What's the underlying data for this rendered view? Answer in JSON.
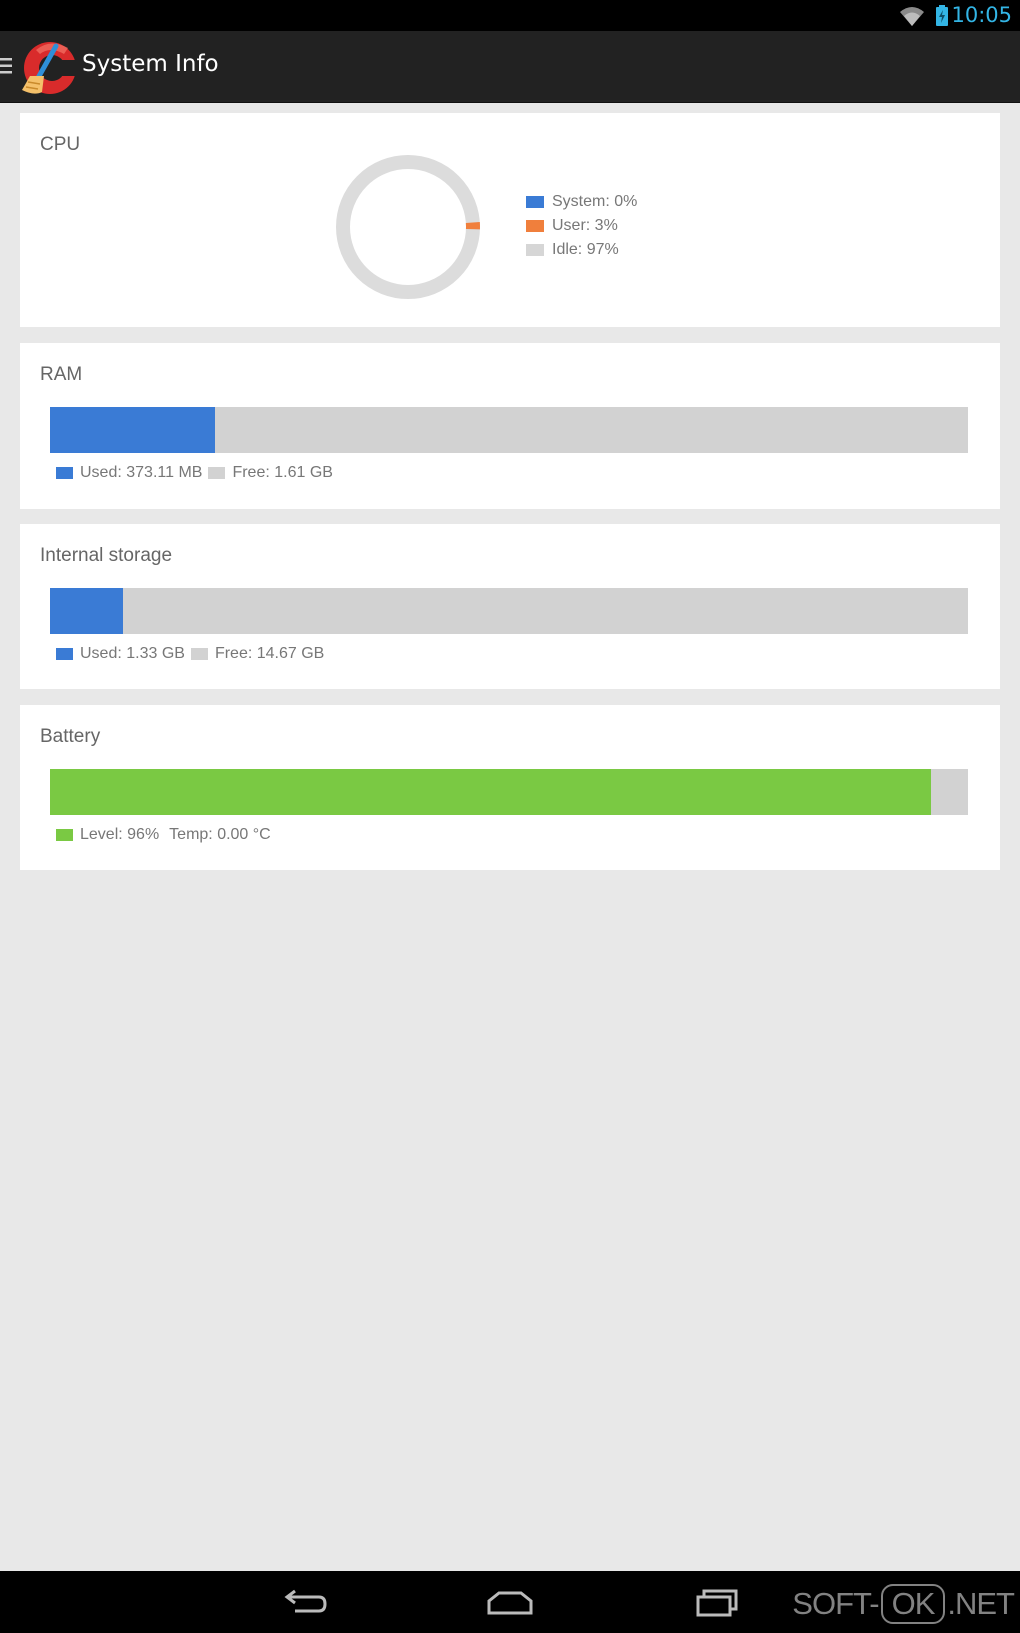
{
  "status_bar": {
    "time": "10:05",
    "icons": [
      "wifi-icon",
      "battery-icon"
    ]
  },
  "app_bar": {
    "title": "System Info",
    "icons": [
      "menu-icon",
      "ccleaner-logo-icon"
    ]
  },
  "cpu": {
    "title": "CPU",
    "legend": [
      {
        "label": "System: 0%",
        "color": "#3a7bd5"
      },
      {
        "label": "User: 3%",
        "color": "#f07f3c"
      },
      {
        "label": "Idle: 97%",
        "color": "#d6d6d6"
      }
    ],
    "usage_percent": {
      "system": 0,
      "user": 3,
      "idle": 97
    }
  },
  "ram": {
    "title": "RAM",
    "used_label": "Used: 373.11 MB",
    "free_label": "Free: 1.61 GB",
    "used_fraction": 0.18,
    "used_color": "#3a7bd5",
    "free_color": "#d2d2d2"
  },
  "storage": {
    "title": "Internal storage",
    "used_label": "Used: 1.33 GB",
    "free_label": "Free: 14.67 GB",
    "used_fraction": 0.08,
    "used_color": "#3a7bd5",
    "free_color": "#d2d2d2"
  },
  "battery": {
    "title": "Battery",
    "level_label": "Level: 96%",
    "temp_label": "Temp: 0.00 °C",
    "level_fraction": 0.96,
    "level_color": "#7ac943"
  },
  "nav_bar": {
    "icons": [
      "back-icon",
      "home-icon",
      "recent-apps-icon"
    ]
  },
  "watermark": {
    "prefix": "SOFT-",
    "box": "OK",
    "suffix": ".NET"
  }
}
